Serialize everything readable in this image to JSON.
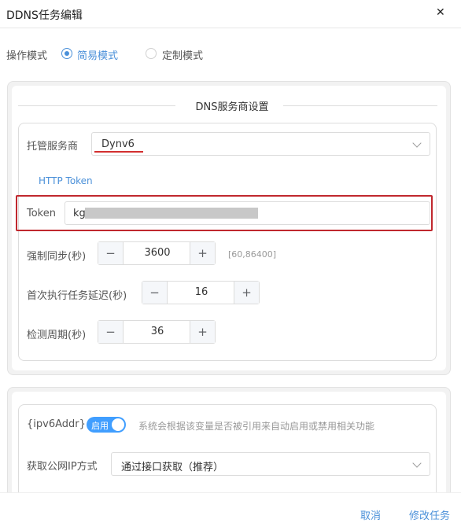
{
  "dialog": {
    "title": "DDNS任务编辑"
  },
  "mode": {
    "label": "操作模式",
    "options": [
      {
        "label": "简易模式",
        "selected": true
      },
      {
        "label": "定制模式",
        "selected": false
      }
    ]
  },
  "dns_section": {
    "title": "DNS服务商设置",
    "provider_label": "托管服务商",
    "provider_value": "Dynv6",
    "token_link": "HTTP Token",
    "token_label": "Token",
    "token_value": "kg",
    "force_sync": {
      "label": "强制同步(秒)",
      "value": "3600",
      "range": "[60,86400]"
    },
    "first_delay": {
      "label": "首次执行任务延迟(秒)",
      "value": "16"
    },
    "check_period": {
      "label": "检测周期(秒)",
      "value": "36"
    }
  },
  "ipv6_section": {
    "var_label": "{ipv6Addr}",
    "toggle_label": "启用",
    "toggle_desc": "系统会根据该变量是否被引用来自动启用或禁用相关功能",
    "fetch_label": "获取公网IP方式",
    "fetch_value": "通过接口获取（推荐）"
  },
  "footer": {
    "cancel": "取消",
    "submit": "修改任务"
  },
  "colors": {
    "accent": "#4a90d9",
    "highlight": "#c0282e",
    "toggle_on": "#409eff"
  }
}
